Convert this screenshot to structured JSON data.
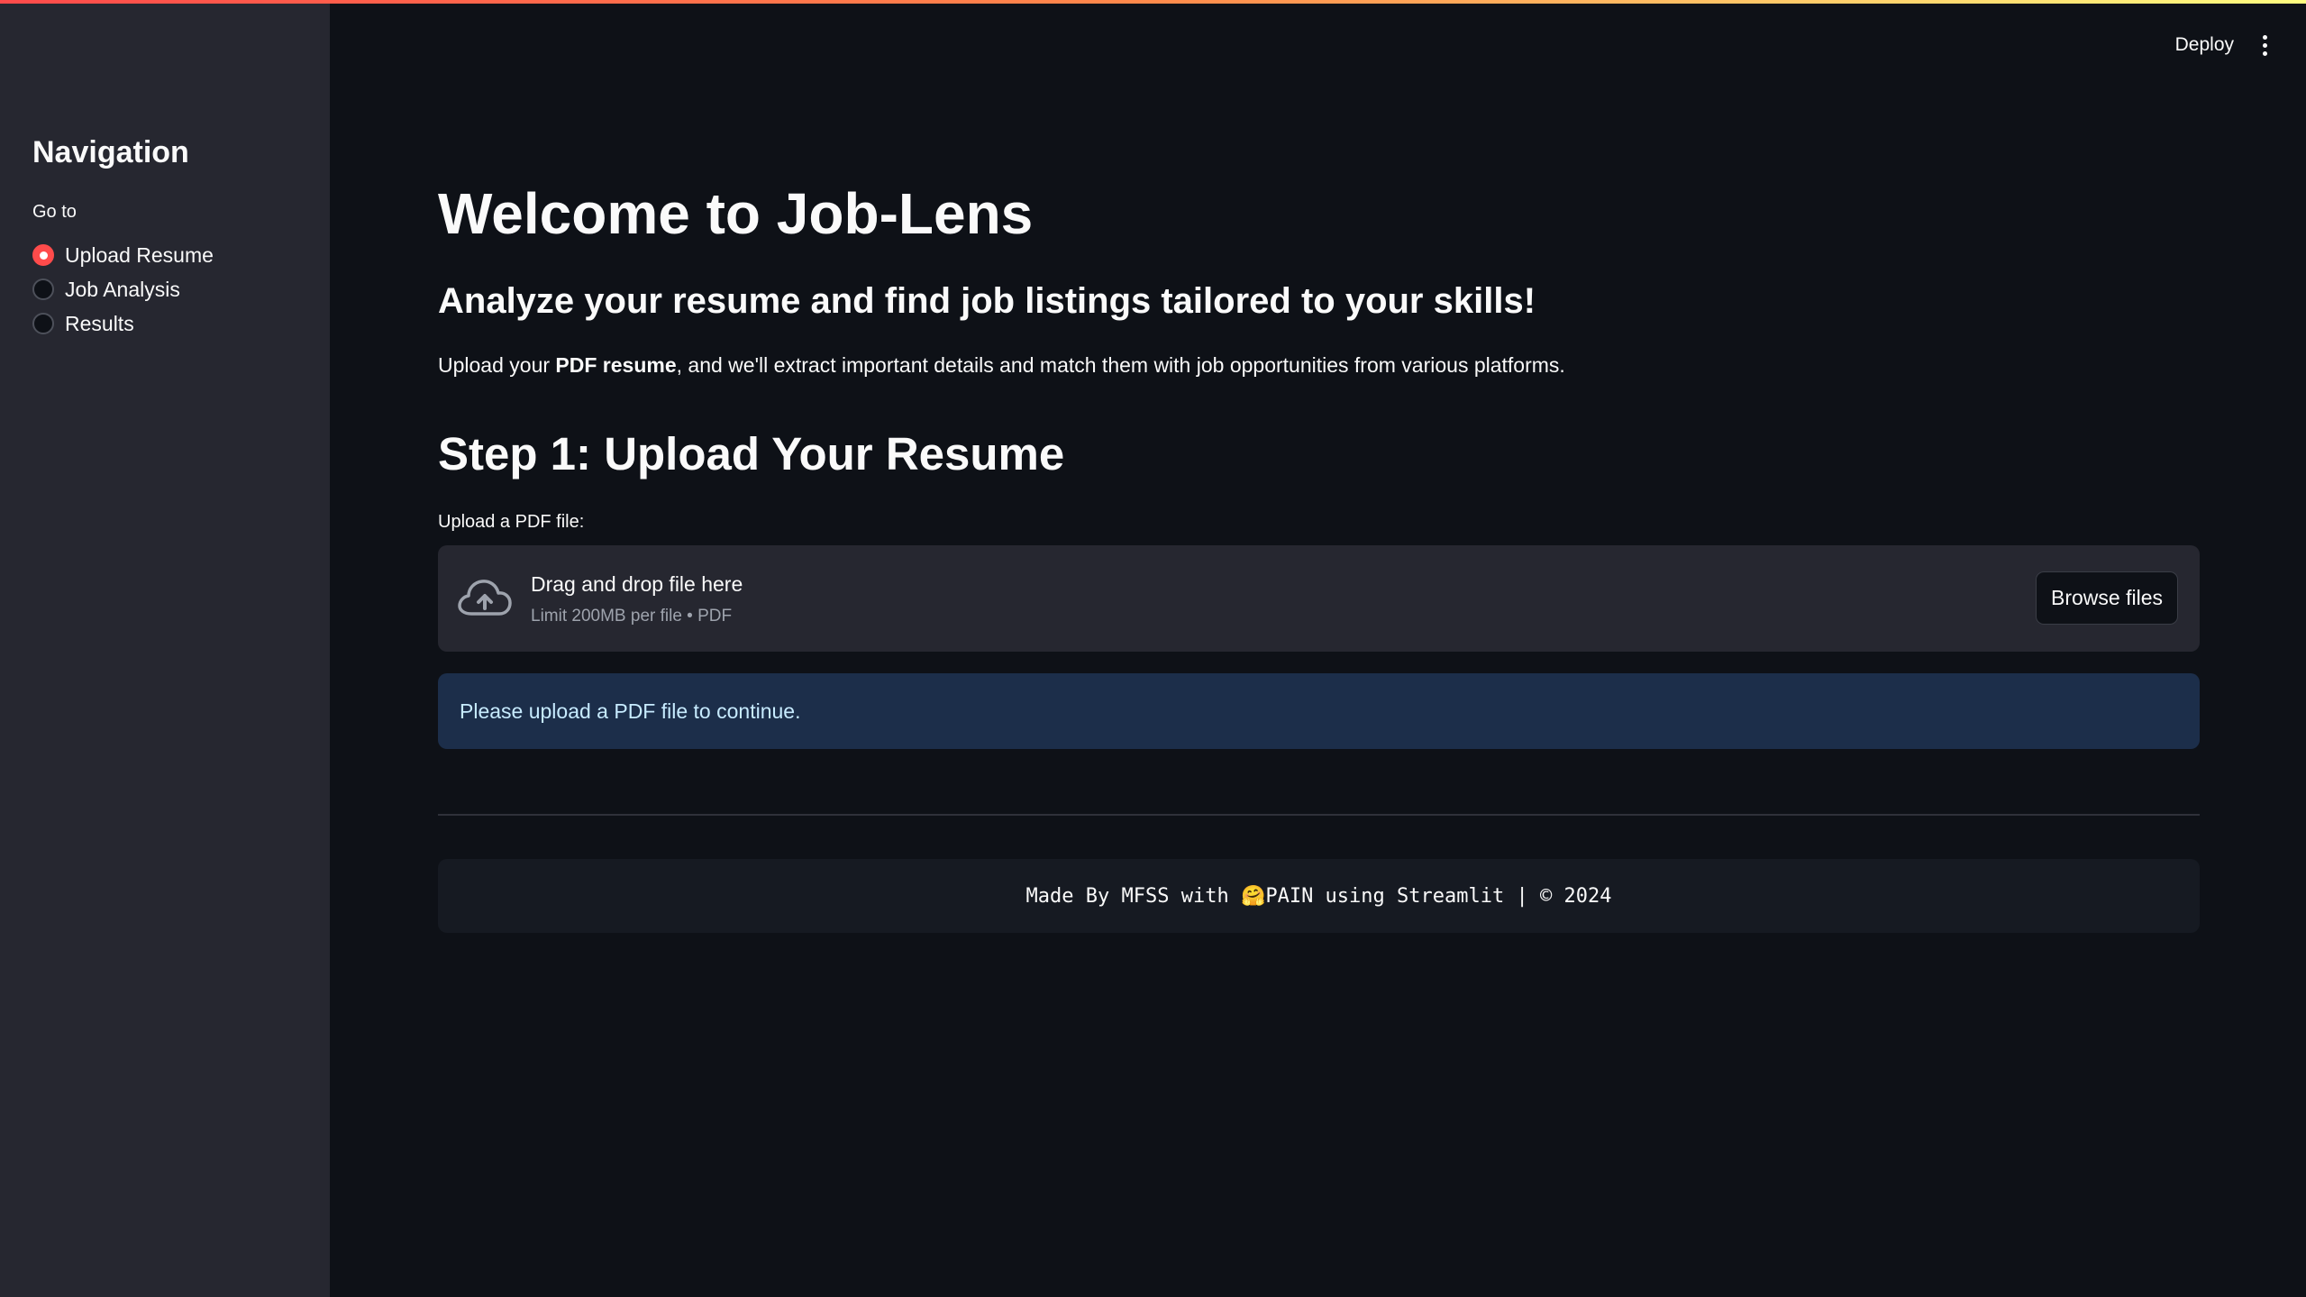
{
  "colors": {
    "background": "#0e1117",
    "sidebar": "#262730",
    "accent": "#ff4b4b",
    "info_bg": "#1c2e4a",
    "info_text": "#c7ebff"
  },
  "header": {
    "deploy_label": "Deploy",
    "menu_icon": "vertical-ellipsis-icon"
  },
  "sidebar": {
    "title": "Navigation",
    "radio_label": "Go to",
    "options": [
      {
        "label": "Upload Resume",
        "selected": true
      },
      {
        "label": "Job Analysis",
        "selected": false
      },
      {
        "label": "Results",
        "selected": false
      }
    ]
  },
  "main": {
    "title": "Welcome to Job-Lens",
    "subtitle": "Analyze your resume and find job listings tailored to your skills!",
    "description_prefix": "Upload your ",
    "description_bold": "PDF resume",
    "description_suffix": ", and we'll extract important details and match them with job opportunities from various platforms.",
    "step_title": "Step 1: Upload Your Resume",
    "uploader": {
      "label": "Upload a PDF file:",
      "icon": "cloud-upload-icon",
      "drop_text": "Drag and drop file here",
      "limit_text": "Limit 200MB per file • PDF",
      "browse_label": "Browse files"
    },
    "info_message": "Please upload a PDF file to continue.",
    "footer": "Made By MFSS with 🤗PAIN using Streamlit | © 2024"
  }
}
